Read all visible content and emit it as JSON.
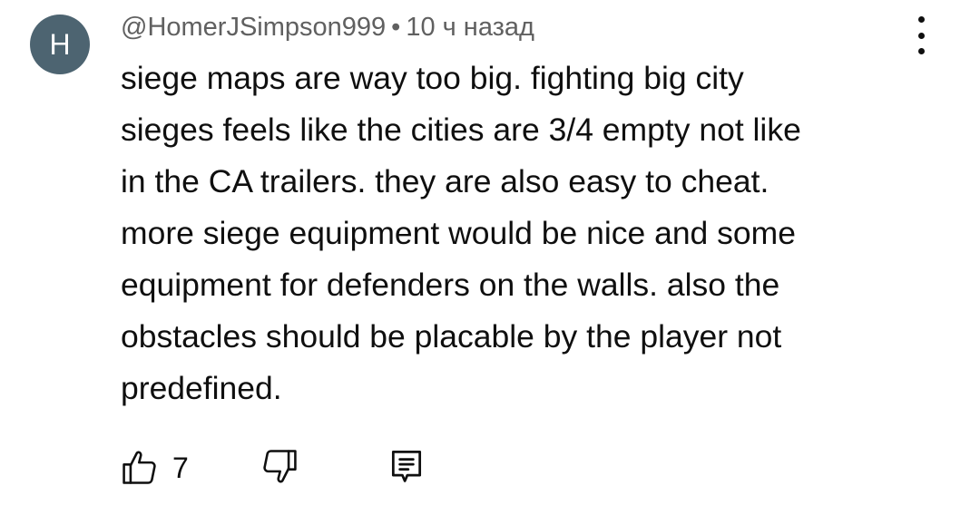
{
  "comment": {
    "avatar_letter": "H",
    "author": "@HomerJSimpson999",
    "separator": "•",
    "timestamp": "10 ч назад",
    "text": "siege maps are way too big. fighting big city\nsieges feels like the cities are 3/4 empty not like\nin the CA trailers. they are also easy to cheat.\nmore siege equipment would be nice and some\nequipment for defenders on the walls. also the\nobstacles should be placable by the player not\npredefined.",
    "like_count": "7"
  },
  "icons": {
    "menu": "more-vert-icon",
    "like": "thumb-up-icon",
    "dislike": "thumb-down-icon",
    "reply": "comment-reply-icon"
  },
  "colors": {
    "avatar_bg": "#4d6471",
    "meta_text": "#606060",
    "body_text": "#0f0f0f"
  }
}
